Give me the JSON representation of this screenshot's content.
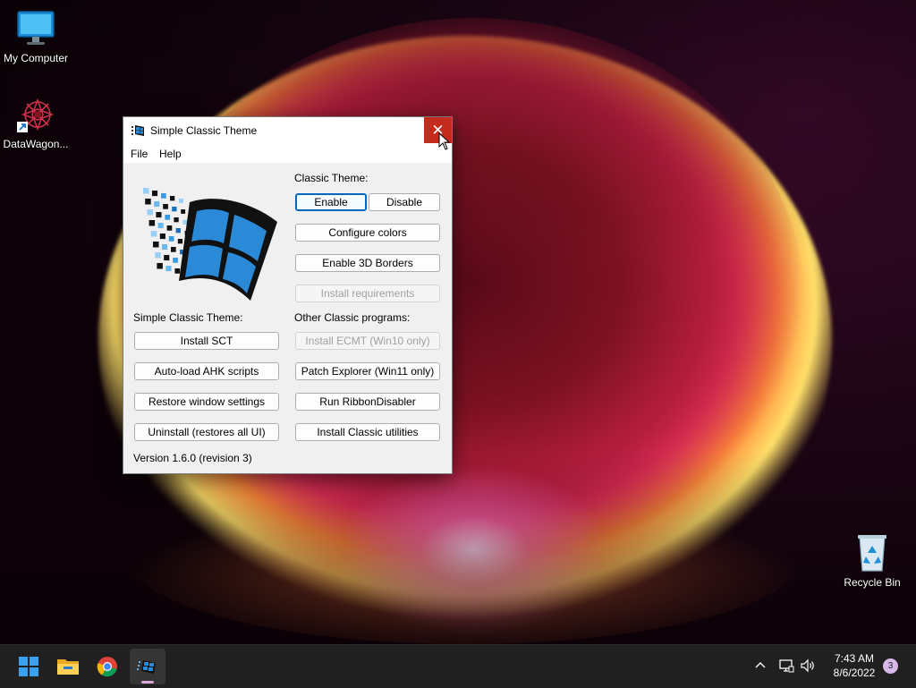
{
  "desktop": {
    "icons": [
      {
        "label": "My Computer",
        "icon": "monitor-icon"
      },
      {
        "label": "DataWagon...",
        "icon": "datawagon-shortcut-icon"
      },
      {
        "label": "Recycle Bin",
        "icon": "recycle-bin-icon"
      }
    ]
  },
  "window": {
    "title": "Simple Classic Theme",
    "menu": [
      "File",
      "Help"
    ],
    "classic_theme_label": "Classic Theme:",
    "enable_label": "Enable",
    "disable_label": "Disable",
    "configure_colors_label": "Configure colors",
    "enable_3d_borders_label": "Enable 3D Borders",
    "install_requirements_label": "Install requirements",
    "sct_section_label": "Simple Classic Theme:",
    "other_section_label": "Other Classic programs:",
    "install_sct_label": "Install SCT",
    "autoload_ahk_label": "Auto-load AHK scripts",
    "restore_window_label": "Restore window settings",
    "uninstall_label": "Uninstall (restores all UI)",
    "install_ecmt_label": "Install ECMT (Win10 only)",
    "patch_explorer_label": "Patch Explorer (Win11 only)",
    "run_ribbon_label": "Run RibbonDisabler",
    "install_utilities_label": "Install Classic utilities",
    "version": "Version 1.6.0 (revision 3)"
  },
  "taskbar": {
    "time": "7:43 AM",
    "date": "8/6/2022",
    "notification_count": "3"
  },
  "colors": {
    "close_button": "#c42b1c",
    "taskbar": "#202020",
    "accent": "#0067c0"
  }
}
